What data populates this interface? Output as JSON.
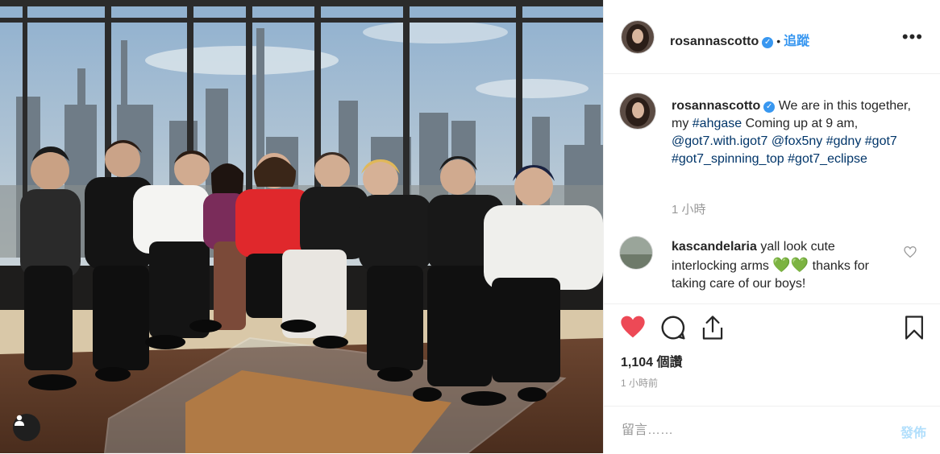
{
  "post": {
    "username": "rosannascotto",
    "follow_label": "追蹤",
    "more_label": "•••",
    "caption": {
      "username": "rosannascotto",
      "segments": [
        {
          "text": "We are in this together, my ",
          "type": "text"
        },
        {
          "text": "#ahgase",
          "type": "link"
        },
        {
          "text": " Coming up at 9 am, ",
          "type": "text"
        },
        {
          "text": "@got7.with.igot7",
          "type": "link"
        },
        {
          "text": " ",
          "type": "text"
        },
        {
          "text": "@fox5ny",
          "type": "link"
        },
        {
          "text": " ",
          "type": "text"
        },
        {
          "text": "#gdny",
          "type": "link"
        },
        {
          "text": " ",
          "type": "text"
        },
        {
          "text": "#got7",
          "type": "link"
        },
        {
          "text": " ",
          "type": "text"
        },
        {
          "text": "#got7_spinning_top",
          "type": "link"
        },
        {
          "text": " ",
          "type": "text"
        },
        {
          "text": "#got7_eclipse",
          "type": "link"
        }
      ],
      "time": "1 小時"
    },
    "comment": {
      "username": "kascandelaria",
      "text_before": "yall look cute interlocking arms",
      "emoji": "💚💚",
      "text_after": "thanks for taking care of our boys!"
    },
    "likes": "1,104 個讚",
    "posted": "1 小時前",
    "add_comment_placeholder": "留言……",
    "post_label": "發佈"
  },
  "icons": {
    "like": "heart-filled-icon",
    "comment": "comment-bubble-icon",
    "share": "share-icon",
    "save": "bookmark-icon",
    "tag": "user-tag-icon"
  },
  "colors": {
    "like_red": "#ed4956",
    "link_blue": "#3897f0",
    "hashtag_navy": "#003569",
    "post_button_disabled": "#b2dffc"
  }
}
